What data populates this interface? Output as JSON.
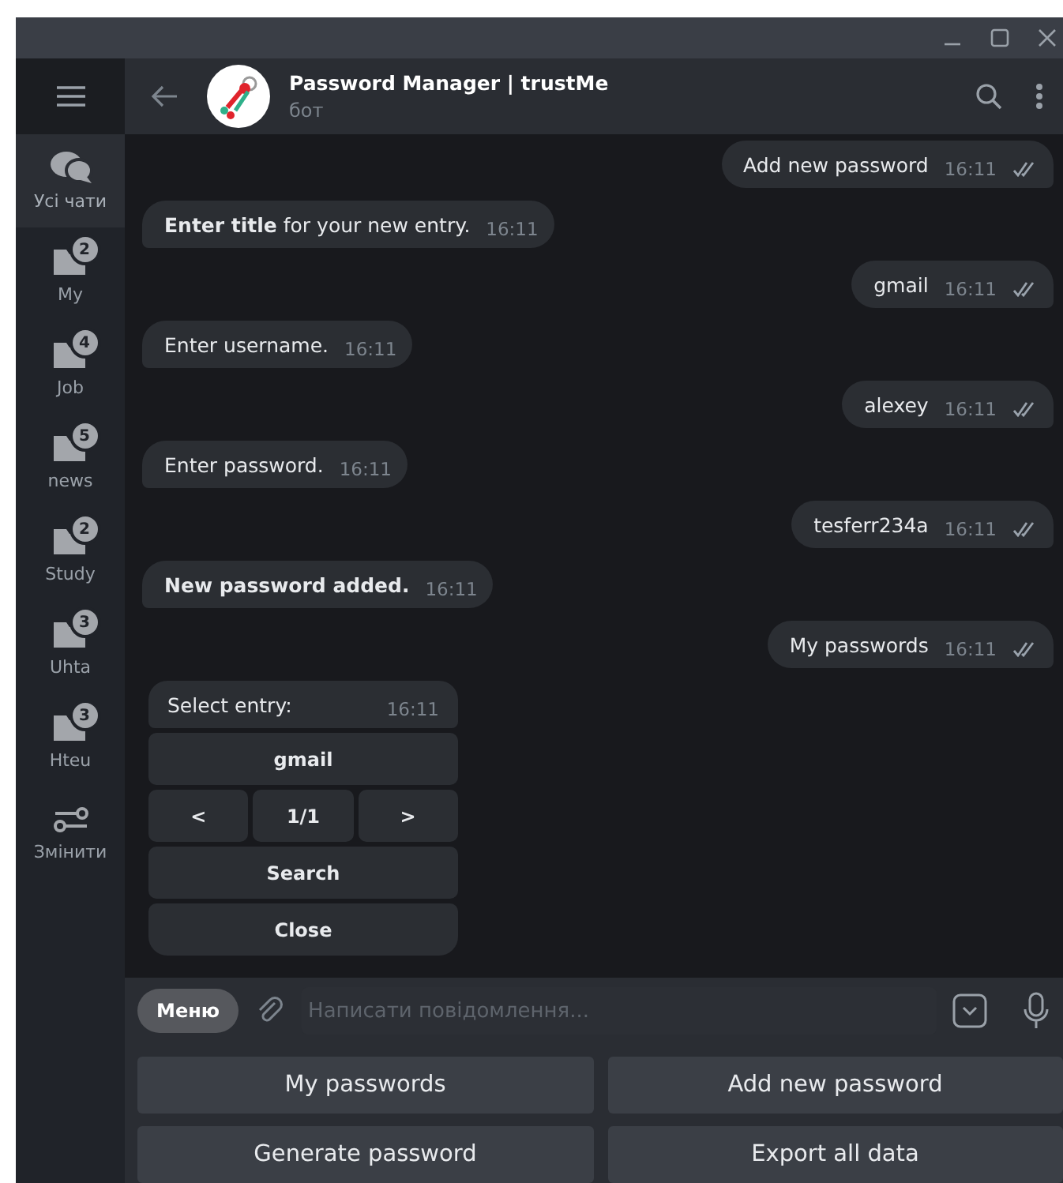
{
  "chat": {
    "title": "Password Manager | trustMe",
    "subtitle": "бот"
  },
  "folders": [
    {
      "label": "Усі чати",
      "kind": "all",
      "selected": true
    },
    {
      "label": "My",
      "kind": "folder",
      "badge": "2",
      "selected": false
    },
    {
      "label": "Job",
      "kind": "folder",
      "badge": "4",
      "selected": false
    },
    {
      "label": "news",
      "kind": "folder",
      "badge": "5",
      "selected": false
    },
    {
      "label": "Study",
      "kind": "folder",
      "badge": "2",
      "selected": false
    },
    {
      "label": "Uhta",
      "kind": "folder",
      "badge": "3",
      "selected": false
    },
    {
      "label": "Hteu",
      "kind": "folder",
      "badge": "3",
      "selected": false
    },
    {
      "label": "Змінити",
      "kind": "edit",
      "selected": false
    }
  ],
  "messages": [
    {
      "kind": "out",
      "text": "Add new password",
      "time": "16:11",
      "read": true
    },
    {
      "kind": "in",
      "text": "**Enter title** for your new entry.",
      "time": "16:11"
    },
    {
      "kind": "out",
      "text": "gmail",
      "time": "16:11",
      "read": true
    },
    {
      "kind": "in",
      "text": "Enter username.",
      "time": "16:11"
    },
    {
      "kind": "out",
      "text": "alexey",
      "time": "16:11",
      "read": true
    },
    {
      "kind": "in",
      "text": "Enter password.",
      "time": "16:11"
    },
    {
      "kind": "out",
      "text": "tesferr234a",
      "time": "16:11",
      "read": true
    },
    {
      "kind": "in",
      "text": "**New password added.**",
      "time": "16:11"
    },
    {
      "kind": "out",
      "text": "My passwords",
      "time": "16:11",
      "read": true
    },
    {
      "kind": "in",
      "text": "Select entry:",
      "time": "16:11",
      "keyboard": [
        [
          "gmail"
        ],
        [
          "<",
          "1/1",
          ">"
        ],
        [
          "Search"
        ],
        [
          "Close"
        ]
      ]
    }
  ],
  "composer": {
    "menu_button": "Меню",
    "placeholder": "Написати повідомлення..."
  },
  "reply_keyboard": [
    [
      "My passwords",
      "Add new password"
    ],
    [
      "Generate password",
      "Export all data"
    ]
  ]
}
